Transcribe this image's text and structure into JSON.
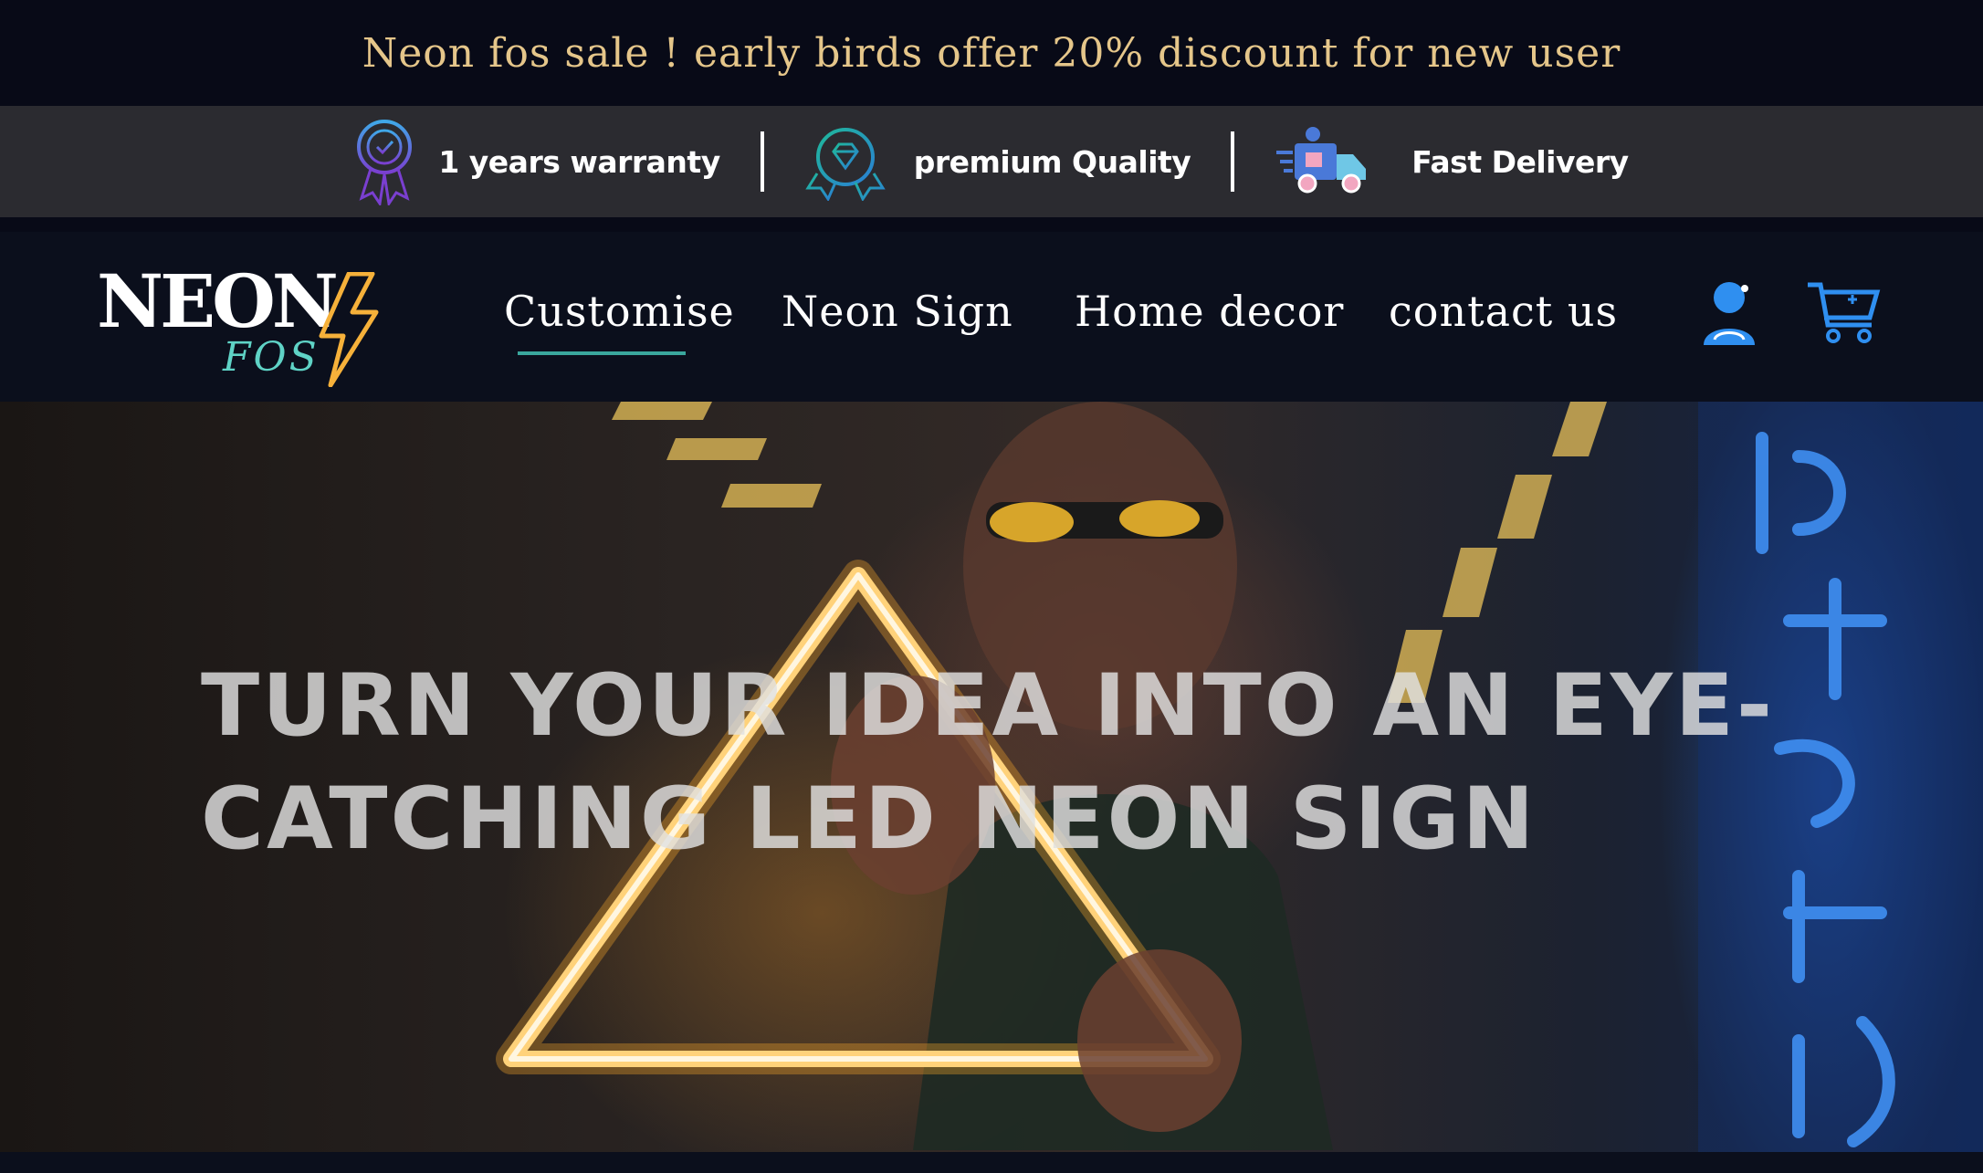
{
  "announcement": {
    "text": "Neon fos sale ! early birds offer 20% discount for new user"
  },
  "features": [
    {
      "label": "1 years warranty",
      "icon": "award-ribbon-icon"
    },
    {
      "label": "premium Quality",
      "icon": "diamond-badge-icon"
    },
    {
      "label": "Fast Delivery",
      "icon": "delivery-truck-icon"
    }
  ],
  "logo": {
    "line1": "NEON",
    "line2": "FOS"
  },
  "nav": {
    "items": [
      {
        "label": "Customise",
        "active": true
      },
      {
        "label": "Neon Sign"
      },
      {
        "label": "Home decor"
      },
      {
        "label": "contact us"
      }
    ],
    "account_icon": "user-icon",
    "cart_icon": "cart-icon"
  },
  "hero": {
    "headline": "TURN YOUR IDEA INTO AN EYE-CATCHING LED NEON SIGN"
  },
  "colors": {
    "announce_text": "#e5c68a",
    "accent": "#3aa79d",
    "icon_blue": "#2f8ff0",
    "neon_orange": "#f6b13a"
  }
}
